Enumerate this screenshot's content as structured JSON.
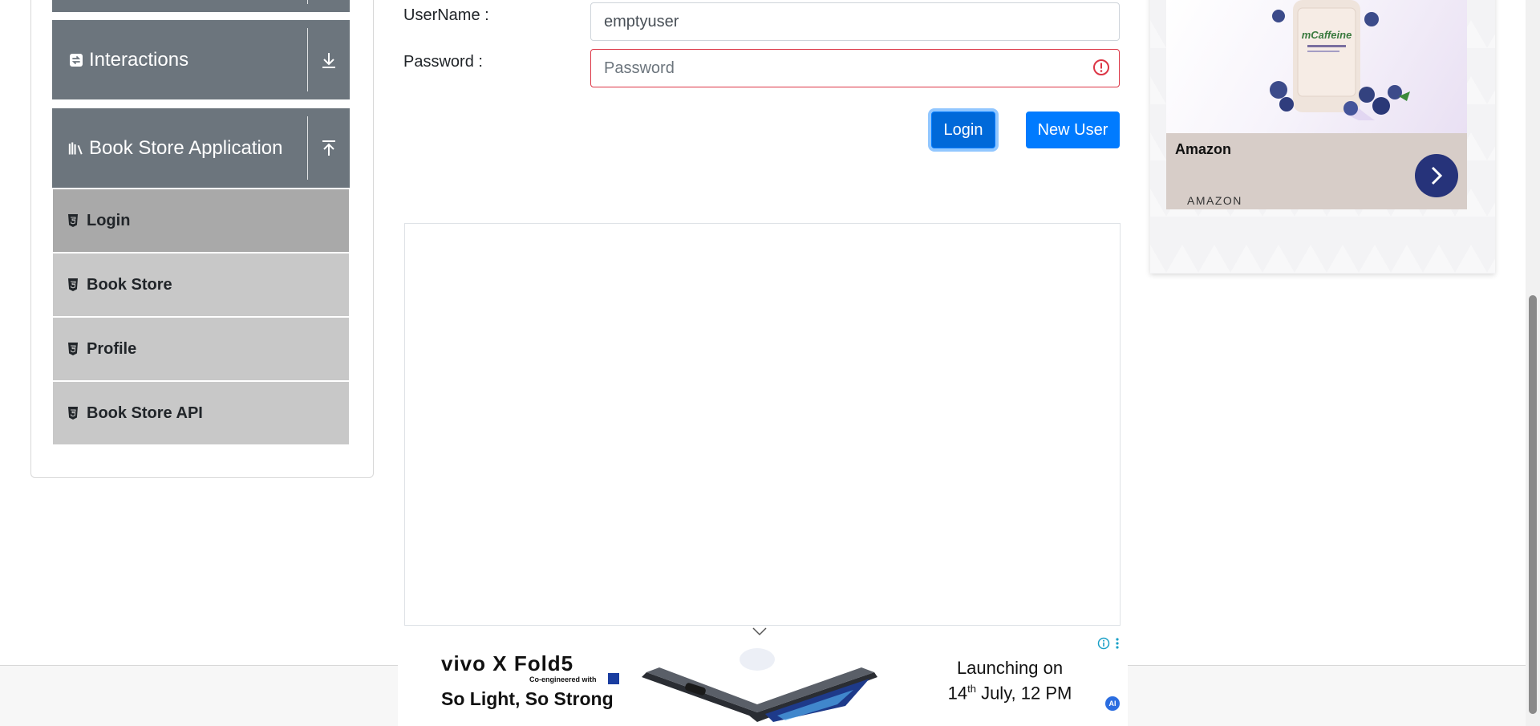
{
  "sidebar": {
    "groups": [
      {
        "label": "Interactions",
        "icon": "interactions-icon",
        "toggle": "download-arrow-icon"
      },
      {
        "label": "Book Store Application",
        "icon": "books-icon",
        "toggle": "upload-arrow-icon"
      }
    ],
    "items": [
      {
        "label": "Login",
        "active": true
      },
      {
        "label": "Book Store",
        "active": false
      },
      {
        "label": "Profile",
        "active": false
      },
      {
        "label": "Book Store API",
        "active": false
      }
    ]
  },
  "form": {
    "username_label": "UserName :",
    "username_value": "emptyuser",
    "password_label": "Password :",
    "password_value": "",
    "password_placeholder": "Password",
    "login_button": "Login",
    "new_user_button": "New User"
  },
  "ad_right": {
    "brand": "Amazon",
    "sub": "AMAZON",
    "product_label": "mCaffeine"
  },
  "ad_bottom": {
    "brand": "vivo X Fold5",
    "coengineered": "Co-engineered with",
    "tagline": "So Light, So Strong",
    "launch_line1": "Launching on",
    "launch_line2_pre": "14",
    "launch_line2_sup": "th",
    "launch_line2_post": " July, 12 PM",
    "ai_badge": "AI"
  },
  "colors": {
    "primary": "#007bff",
    "sidebar_header": "#6c757d",
    "menu_item": "#c8c8c8",
    "menu_item_active": "#a9a9a9",
    "invalid": "#dc3545"
  }
}
